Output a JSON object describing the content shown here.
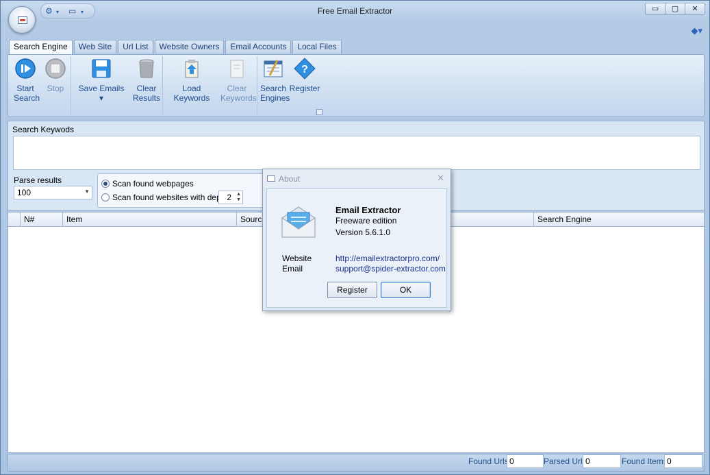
{
  "window": {
    "title": "Free Email Extractor",
    "controls": {
      "minimize": "▭",
      "maximize": "▢",
      "close": "✕"
    }
  },
  "ribbon": {
    "tabs": [
      {
        "label": "Search Engine",
        "active": true
      },
      {
        "label": "Web Site",
        "active": false
      },
      {
        "label": "Url List",
        "active": false
      },
      {
        "label": "Website Owners",
        "active": false
      },
      {
        "label": "Email Accounts",
        "active": false
      },
      {
        "label": "Local Files",
        "active": false
      }
    ],
    "buttons": {
      "start_search": {
        "line1": "Start",
        "line2": "Search"
      },
      "stop": {
        "line1": "Stop"
      },
      "save_emails": {
        "line1": "Save Emails ▾"
      },
      "clear_results": {
        "line1": "Clear",
        "line2": "Results"
      },
      "load_keywords": {
        "line1": "Load Keywords"
      },
      "clear_keywords": {
        "line1": "Clear",
        "line2": "Keywords"
      },
      "search_engines": {
        "line1": "Search",
        "line2": "Engines"
      },
      "register": {
        "line1": "Register"
      }
    }
  },
  "search_panel": {
    "keywords_label": "Search Keywods",
    "keywords_value": "",
    "parse_results_label": "Parse results",
    "parse_results_value": "100",
    "scan_webpages_label": "Scan found webpages",
    "scan_websites_label": "Scan found websites with depth",
    "depth_value": "2",
    "selected_scan_option": "webpages"
  },
  "results_grid": {
    "columns": [
      "N#",
      "Item",
      "Source",
      "Search Engine"
    ],
    "rows": []
  },
  "status_bar": {
    "found_urls_label": "Found Urls",
    "found_urls_value": "0",
    "parsed_urls_label": "Parsed Urls",
    "parsed_urls_value": "0",
    "found_items_label": "Found Items",
    "found_items_value": "0"
  },
  "about_dialog": {
    "title": "About",
    "product": "Email Extractor",
    "edition": "Freeware edition",
    "version": "Version 5.6.1.0",
    "website_label": "Website",
    "website_value": "http://emailextractorpro.com/",
    "email_label": "Email",
    "email_value": "support@spider-extractor.com",
    "register_button": "Register",
    "ok_button": "OK"
  },
  "colors": {
    "accent": "#2f66b8",
    "ribbon_text": "#1c4c8e",
    "link": "#1a2f8a"
  }
}
